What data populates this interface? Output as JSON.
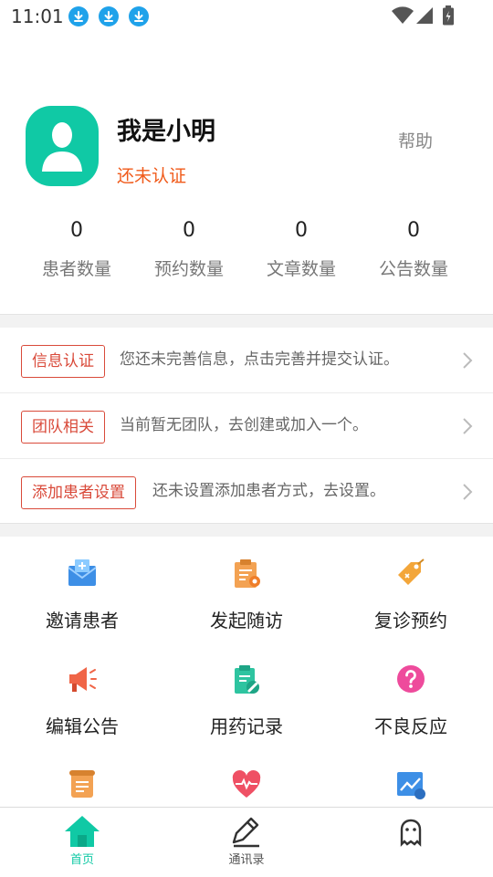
{
  "status_bar": {
    "time": "11:01",
    "download_icons": [
      "download-icon",
      "download-icon",
      "download-icon"
    ],
    "system_icons": [
      "wifi-icon",
      "signal-icon",
      "battery-icon"
    ]
  },
  "profile": {
    "name": "我是小明",
    "verify_status": "还未认证",
    "help_label": "帮助",
    "colors": {
      "avatar_bg": "#10c9a5",
      "verify_text": "#f05a1a"
    }
  },
  "stats": [
    {
      "value": "0",
      "label": "患者数量"
    },
    {
      "value": "0",
      "label": "预约数量"
    },
    {
      "value": "0",
      "label": "文章数量"
    },
    {
      "value": "0",
      "label": "公告数量"
    }
  ],
  "info_rows": [
    {
      "tag": "信息认证",
      "text": "您还未完善信息，点击完善并提交认证。"
    },
    {
      "tag": "团队相关",
      "text": "当前暂无团队，去创建或加入一个。"
    },
    {
      "tag": "添加患者设置",
      "text": "还未设置添加患者方式，去设置。"
    }
  ],
  "features": [
    {
      "label": "邀请患者",
      "icon": "envelope-plus-icon"
    },
    {
      "label": "发起随访",
      "icon": "clipboard-gear-icon"
    },
    {
      "label": "复诊预约",
      "icon": "tag-icon"
    },
    {
      "label": "编辑公告",
      "icon": "megaphone-icon"
    },
    {
      "label": "用药记录",
      "icon": "medicine-clipboard-icon"
    },
    {
      "label": "不良反应",
      "icon": "question-icon"
    },
    {
      "label": "",
      "icon": "scroll-icon"
    },
    {
      "label": "",
      "icon": "heart-pulse-icon"
    },
    {
      "label": "",
      "icon": "chart-icon"
    }
  ],
  "bottom_nav": [
    {
      "label": "首页",
      "icon": "home-icon",
      "active": true
    },
    {
      "label": "通讯录",
      "icon": "pencil-icon",
      "active": false
    },
    {
      "label": "",
      "icon": "ghost-icon",
      "active": false
    }
  ],
  "colors": {
    "accent": "#10c9a5",
    "tag_border": "#d94a3a"
  }
}
